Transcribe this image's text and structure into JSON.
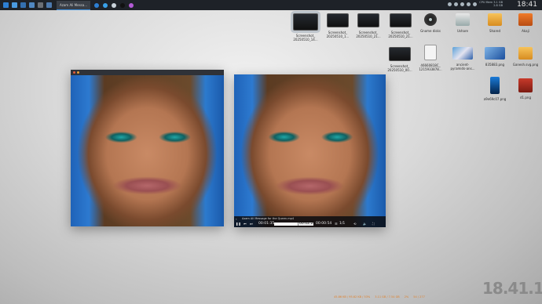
{
  "panel": {
    "task_label": "Azam Ali Messa...",
    "tray_text_top": "CPU  Mem  3.1 GB",
    "tray_text_bottom": "2.8 GB",
    "clock": "18:41"
  },
  "desktop_icons": [
    {
      "label": "Screenshot_\n20250510_14..."
    },
    {
      "label": "Screenshot_\n20250510_1..."
    },
    {
      "label": "Screenshot_\n20250510_21..."
    },
    {
      "label": "Screenshot_\n20250510_21..."
    },
    {
      "label": "Gnome disks"
    },
    {
      "label": "Ushare"
    },
    {
      "label": "Shared"
    },
    {
      "label": "Akaji"
    },
    {
      "label": "Screenshot_\n20250510_00..."
    },
    {
      "label": "46660818C_\n1215933878..."
    },
    {
      "label": "ancient-\npyramids-ans..."
    },
    {
      "label": "835883.png"
    },
    {
      "label": "Ganesh.svg.png"
    },
    {
      "label": "a9e69c07.png"
    },
    {
      "label": "d1.png"
    }
  ],
  "player": {
    "title": "Azam Ali Message for the Queen.mp4",
    "elapsed": "00:01:35",
    "position": "00:02:24",
    "remaining": "00:00:54",
    "count": "1/1",
    "progress_fraction": 0.6
  },
  "bottom_stats": {
    "net": "45.86 KB / 95.62 KB / 53%",
    "disk": "3.11 GB / 7.54 GB",
    "cpu": "2%",
    "temp": "54 / 277"
  },
  "big_clock": {
    "hours_minutes": "18.41.18",
    "seconds": "20"
  }
}
